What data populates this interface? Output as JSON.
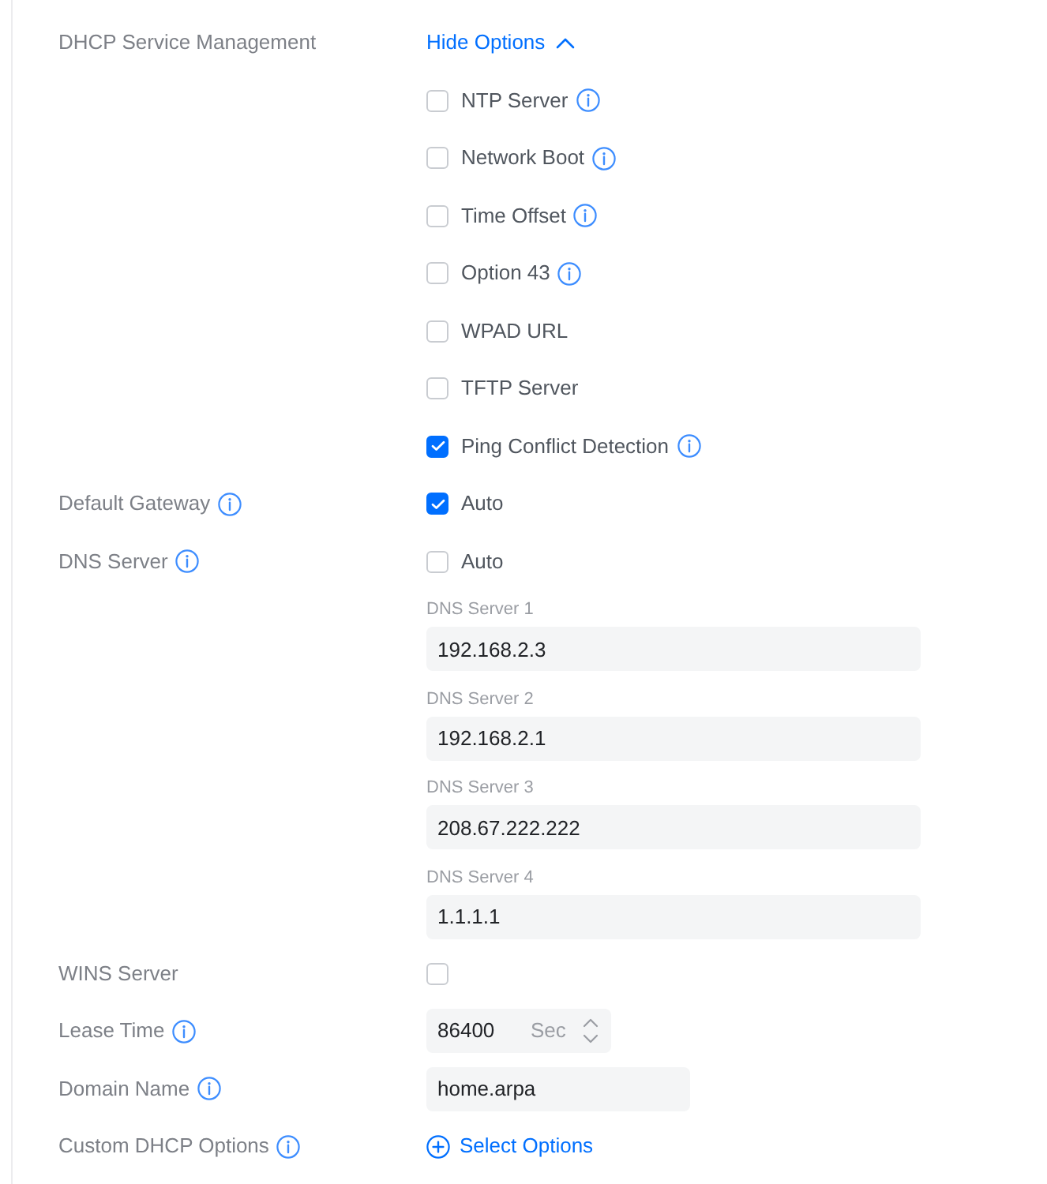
{
  "fields": [
    {
      "kind": "options",
      "label": "DHCP Service Management",
      "toggle": {
        "text": "Hide Options",
        "expanded": true
      },
      "options": [
        {
          "label": "NTP Server",
          "checked": false,
          "info": true
        },
        {
          "label": "Network Boot",
          "checked": false,
          "info": true
        },
        {
          "label": "Time Offset",
          "checked": false,
          "info": true
        },
        {
          "label": "Option 43",
          "checked": false,
          "info": true
        },
        {
          "label": "WPAD URL",
          "checked": false
        },
        {
          "label": "TFTP Server",
          "checked": false
        },
        {
          "label": "Ping Conflict Detection",
          "checked": true,
          "info": true
        }
      ]
    },
    {
      "kind": "checkbox",
      "label": "Default Gateway",
      "info": true,
      "checkbox": {
        "label": "Auto",
        "checked": true
      }
    },
    {
      "kind": "dns",
      "label": "DNS Server",
      "info": true,
      "checkbox": {
        "label": "Auto",
        "checked": false
      },
      "servers": [
        {
          "label": "DNS Server 1",
          "value": "192.168.2.3"
        },
        {
          "label": "DNS Server 2",
          "value": "192.168.2.1"
        },
        {
          "label": "DNS Server 3",
          "value": "208.67.222.222"
        },
        {
          "label": "DNS Server 4",
          "value": "1.1.1.1"
        }
      ]
    },
    {
      "kind": "checkbox",
      "label": "WINS Server",
      "checkbox": {
        "checked": false
      }
    },
    {
      "kind": "number",
      "label": "Lease Time",
      "info": true,
      "value": "86400",
      "unit": "Sec"
    },
    {
      "kind": "text",
      "label": "Domain Name",
      "info": true,
      "value": "home.arpa"
    },
    {
      "kind": "action",
      "label": "Custom DHCP Options",
      "info": true,
      "action": "Select Options"
    }
  ]
}
